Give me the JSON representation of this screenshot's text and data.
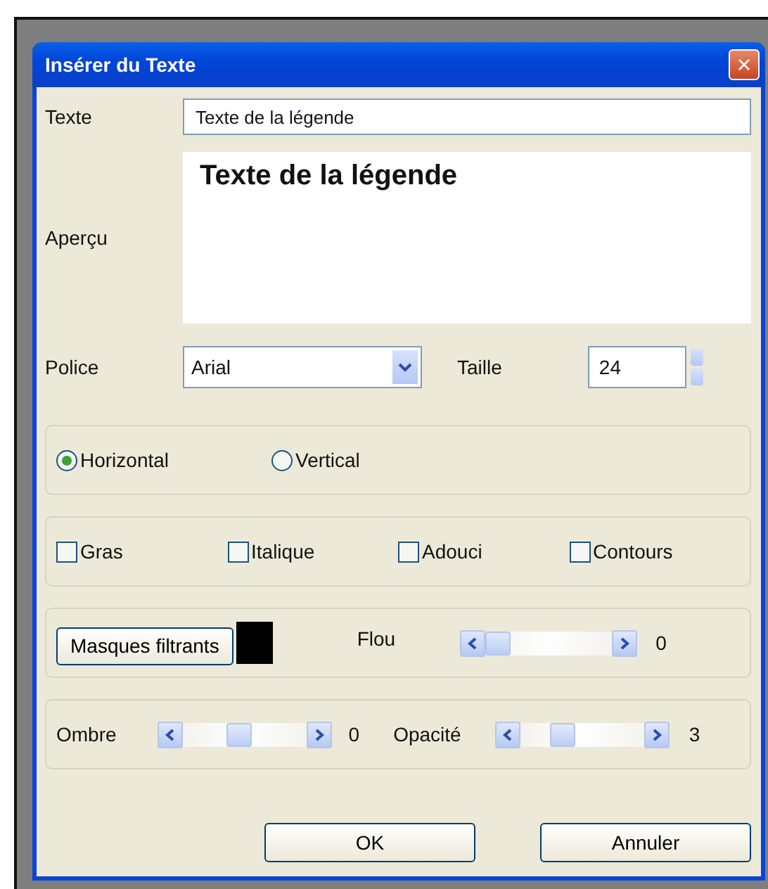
{
  "window": {
    "title": "Insérer du Texte",
    "close": "×"
  },
  "text_field": {
    "label": "Texte",
    "value": "Texte de la légende"
  },
  "preview": {
    "label": "Aperçu",
    "text": "Texte de la légende"
  },
  "font": {
    "label": "Police",
    "value": "Arial"
  },
  "size": {
    "label": "Taille",
    "value": "24"
  },
  "orientation": [
    {
      "label": "Horizontal",
      "selected": true
    },
    {
      "label": "Vertical",
      "selected": false
    }
  ],
  "styles": [
    {
      "label": "Gras",
      "checked": false
    },
    {
      "label": "Italique",
      "checked": false
    },
    {
      "label": "Adouci",
      "checked": false
    },
    {
      "label": "Contours",
      "checked": false
    }
  ],
  "mask": {
    "button": "Masques filtrants",
    "color": "#000000"
  },
  "sliders": [
    {
      "label": "Flou",
      "level": 0,
      "reading": "0"
    },
    {
      "label": "Ombre",
      "level": 0.45,
      "reading": "0"
    },
    {
      "label": "Opacité",
      "level": 0.3,
      "reading": "3"
    }
  ],
  "buttons": [
    "OK",
    "Annuler"
  ]
}
